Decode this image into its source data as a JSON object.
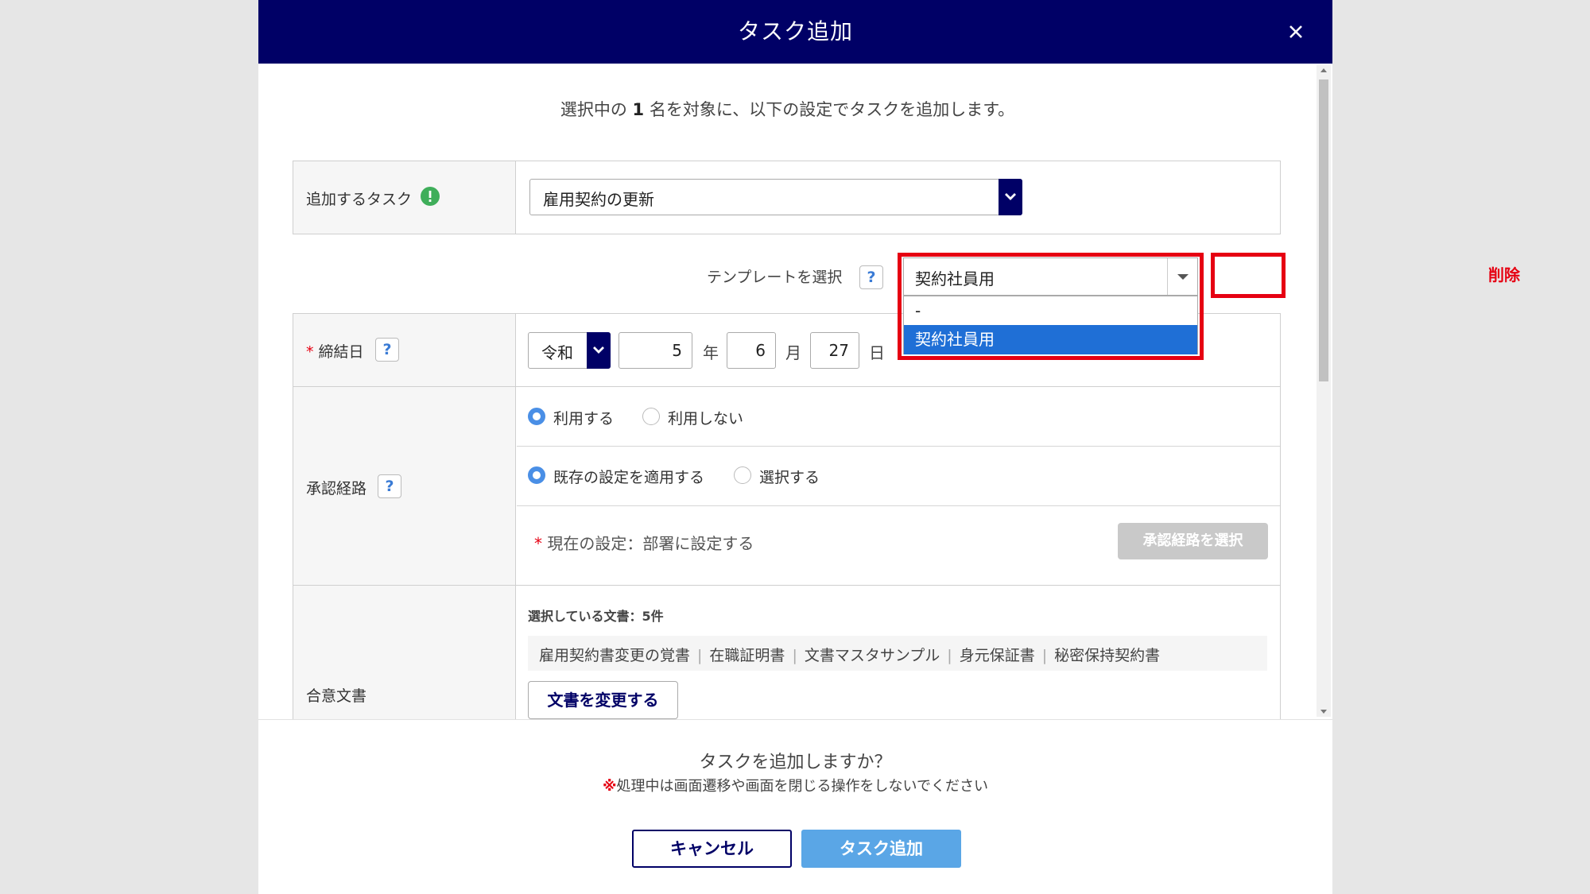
{
  "modal": {
    "title": "タスク追加",
    "close_icon": "close-icon"
  },
  "intro": {
    "before": "選択中の ",
    "count": "1",
    "after": " 名を対象に、以下の設定でタスクを追加します。"
  },
  "task_field": {
    "label": "追加するタスク",
    "info_icon": "info-icon",
    "value": "雇用契約の更新"
  },
  "template": {
    "label": "テンプレートを選択",
    "help": "?",
    "value": "契約社員用",
    "options": [
      "-",
      "契約社員用"
    ],
    "selected_index": 1,
    "delete_label": "削除"
  },
  "contract_date": {
    "required_mark": "*",
    "label": "締結日",
    "help": "?",
    "era": "令和",
    "year": "5",
    "year_unit": "年",
    "month": "6",
    "month_unit": "月",
    "day": "27",
    "day_unit": "日"
  },
  "approval_route": {
    "label": "承認経路",
    "help": "?",
    "use_options": [
      {
        "label": "利用する",
        "checked": true
      },
      {
        "label": "利用しない",
        "checked": false
      }
    ],
    "mode_options": [
      {
        "label": "既存の設定を適用する",
        "checked": true
      },
      {
        "label": "選択する",
        "checked": false
      }
    ],
    "required_mark": "*",
    "current_setting": "現在の設定：部署に設定する",
    "select_button": "承認経路を選択"
  },
  "documents": {
    "label": "合意文書",
    "selected_count": "選択している文書：5件",
    "items": [
      "雇用契約書変更の覚書",
      "在職証明書",
      "文書マスタサンプル",
      "身元保証書",
      "秘密保持契約書"
    ],
    "separator": "|",
    "change_button": "文書を変更する"
  },
  "footer": {
    "question": "タスクを追加しますか？",
    "warning_mark": "※",
    "warning": "処理中は画面遷移や画面を閉じる操作をしないでください",
    "cancel": "キャンセル",
    "submit": "タスク追加"
  },
  "colors": {
    "header_bg": "#000066",
    "highlight_red": "#e60012",
    "selected_option": "#1f6fd6",
    "primary_button": "#5aa6e6",
    "radio_on": "#4a8fe6"
  }
}
